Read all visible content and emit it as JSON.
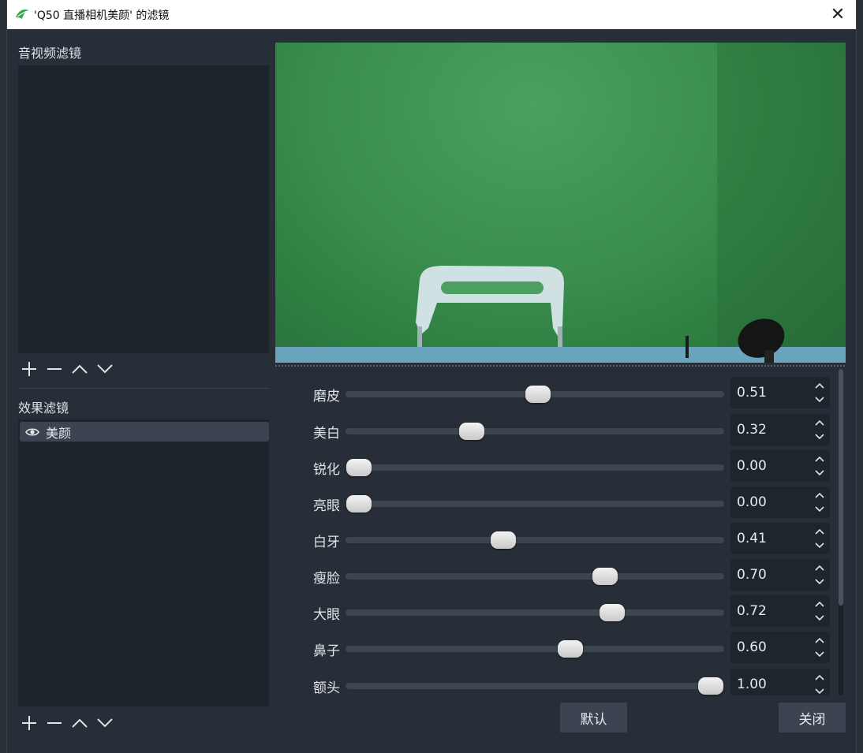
{
  "window": {
    "title": "'Q50 直播相机美颜' 的滤镜",
    "close_glyph": "✕"
  },
  "left_panel": {
    "av_filters_label": "音视频滤镜",
    "effect_filters_label": "效果滤镜",
    "effect_filters": [
      {
        "name": "美颜",
        "icon": "eye-icon",
        "visible": true
      }
    ]
  },
  "toolbar_icons": [
    "add-icon",
    "remove-icon",
    "move-up-icon",
    "move-down-icon"
  ],
  "properties": [
    {
      "label": "磨皮",
      "value": "0.51",
      "fraction": 0.51
    },
    {
      "label": "美白",
      "value": "0.32",
      "fraction": 0.32
    },
    {
      "label": "锐化",
      "value": "0.00",
      "fraction": 0.0
    },
    {
      "label": "亮眼",
      "value": "0.00",
      "fraction": 0.0
    },
    {
      "label": "白牙",
      "value": "0.41",
      "fraction": 0.41
    },
    {
      "label": "瘦脸",
      "value": "0.70",
      "fraction": 0.7
    },
    {
      "label": "大眼",
      "value": "0.72",
      "fraction": 0.72
    },
    {
      "label": "鼻子",
      "value": "0.60",
      "fraction": 0.6
    },
    {
      "label": "额头",
      "value": "1.00",
      "fraction": 1.0
    }
  ],
  "buttons": {
    "defaults": "默认",
    "close": "关闭"
  },
  "colors": {
    "preview_green": "#3a8f4e",
    "panel_bg": "#272e37",
    "list_bg": "#1e242c",
    "selected_item": "#3b4450"
  }
}
